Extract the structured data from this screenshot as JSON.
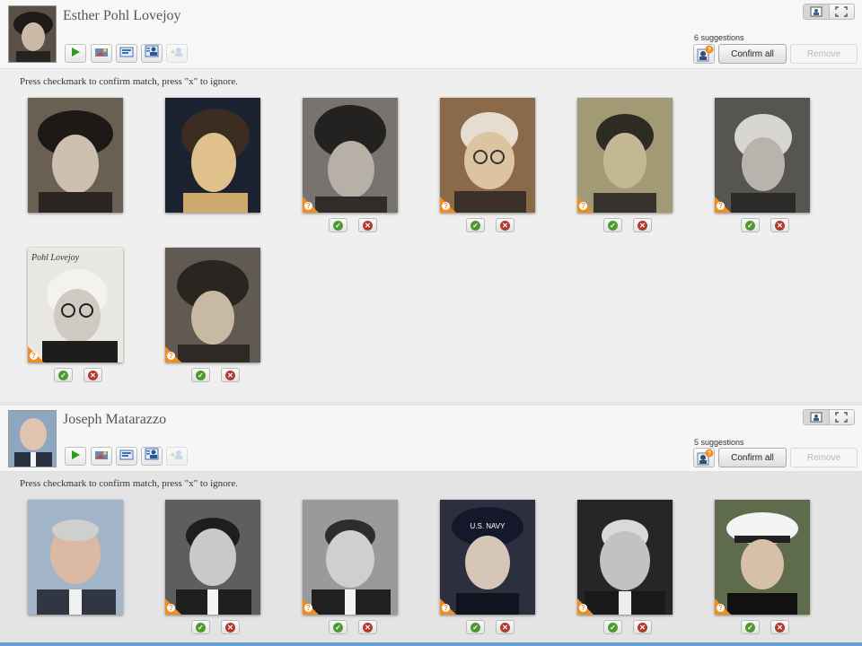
{
  "people": [
    {
      "name": "Esther Pohl Lovejoy",
      "suggestions_count": "6 suggestions",
      "confirm_label": "Confirm all",
      "remove_label": "Remove",
      "instructions": "Press checkmark to confirm match, press \"x\" to ignore.",
      "photo_annotation": "Pohl Lovejoy"
    },
    {
      "name": "Joseph Matarazzo",
      "suggestions_count": "5 suggestions",
      "confirm_label": "Confirm all",
      "remove_label": "Remove",
      "instructions": "Press checkmark to confirm match, press \"x\" to ignore.",
      "photo_text": "U.S. NAVY"
    }
  ],
  "icons": {
    "play": "play-icon",
    "add_photo": "add-photo-icon",
    "contact_card": "contact-card-icon",
    "person_tag": "person-tag-icon",
    "add_person": "add-person-icon",
    "single_view": "single-view-icon",
    "fullscreen": "fullscreen-icon",
    "suggestions": "suggestions-icon",
    "confirm": "checkmark-icon",
    "ignore": "x-icon",
    "question_badge": "question-badge-icon"
  },
  "colors": {
    "accent_green": "#4e9a2e",
    "reject_red": "#b23a32",
    "badge_orange": "#f28c1e"
  }
}
